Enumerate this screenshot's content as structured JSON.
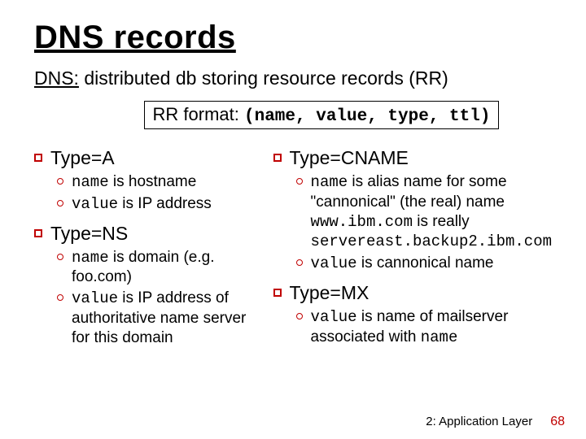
{
  "title": "DNS records",
  "subtitle_pre": "DNS:",
  "subtitle_rest": " distributed db storing resource records (RR)",
  "format": {
    "label": "RR format: ",
    "tuple": "(name, value, type, ttl)"
  },
  "left": {
    "a": {
      "heading": "Type=A",
      "l1_name": "name",
      "l1_rest": " is hostname",
      "l2_name": "value",
      "l2_rest": " is IP address"
    },
    "ns": {
      "heading": "Type=NS",
      "l1_name": "name",
      "l1_rest": " is domain (e.g. foo.com)",
      "l2_name": "value",
      "l2_rest": " is IP address of authoritative name server for this domain"
    }
  },
  "right": {
    "cname": {
      "heading": "Type=CNAME",
      "l1_name": "name",
      "l1_mid": " is alias name for some \"cannonical\" (the real) name",
      "l1_code1": "www.ibm.com",
      "l1_between": " is really ",
      "l1_code2": "servereast.backup2.ibm.com",
      "l2_name": "value",
      "l2_rest": " is cannonical name"
    },
    "mx": {
      "heading": "Type=MX",
      "l1_name": "value",
      "l1_mid": " is name of mailserver associated with ",
      "l1_name2": "name"
    }
  },
  "footer": {
    "chapter": "2: Application Layer",
    "page": "68"
  }
}
